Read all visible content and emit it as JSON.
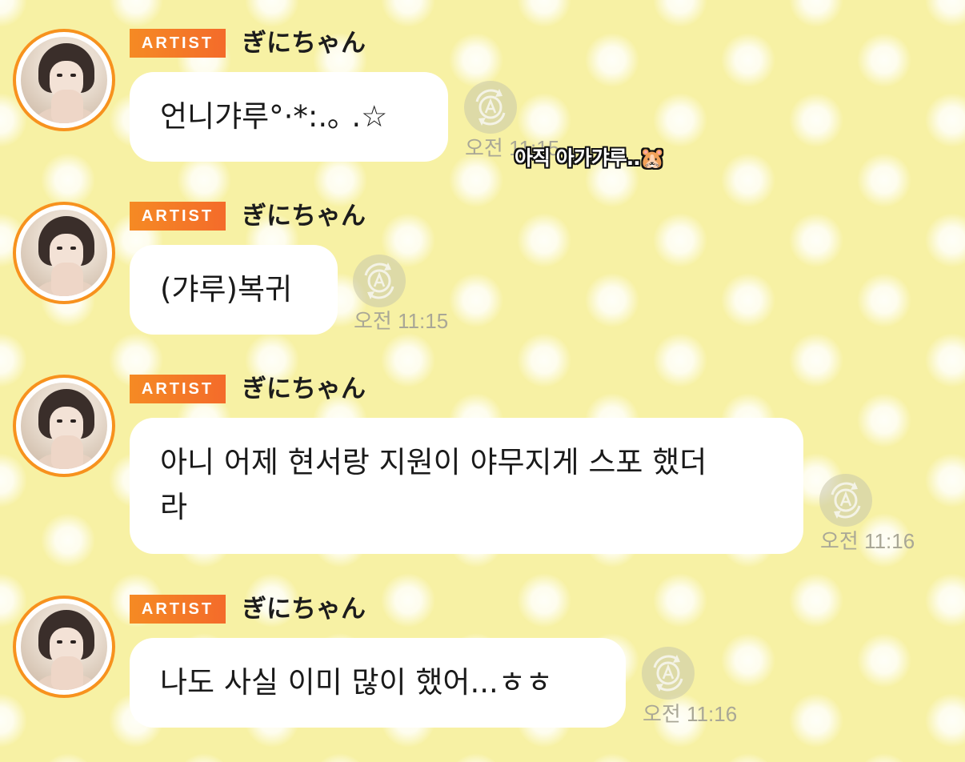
{
  "caption": {
    "text": "아직 아가갸루..🐹"
  },
  "messages": [
    {
      "badge": "ARTIST",
      "sender": "ぎにちゃん",
      "lines": [
        "언니갸루°·*:.｡ .☆"
      ],
      "time": "오전 11:15",
      "translate_icon": "translate-a-icon"
    },
    {
      "badge": "ARTIST",
      "sender": "ぎにちゃん",
      "lines": [
        "(갸루)복귀"
      ],
      "time": "오전 11:15",
      "translate_icon": "translate-a-icon"
    },
    {
      "badge": "ARTIST",
      "sender": "ぎにちゃん",
      "lines": [
        "아니 어제 현서랑 지원이 야무지게 스포 했더",
        "라"
      ],
      "time": "오전 11:16",
      "translate_icon": "translate-a-icon"
    },
    {
      "badge": "ARTIST",
      "sender": "ぎにちゃん",
      "lines": [
        "나도 사실 이미 많이 했어...ㅎㅎ"
      ],
      "time": "오전 11:16",
      "translate_icon": "translate-a-icon"
    }
  ],
  "colors": {
    "background": "#f7f1a4",
    "badge": "#f58a24",
    "avatar_ring": "#f7921e",
    "bubble": "#ffffff",
    "time_text": "#a9a796"
  }
}
